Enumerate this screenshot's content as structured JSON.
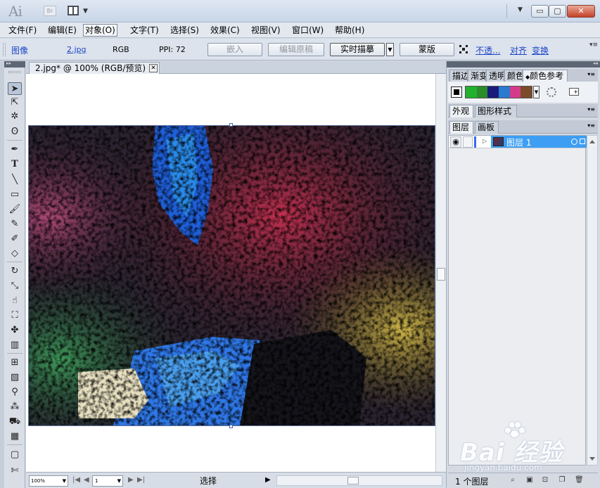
{
  "title_bar": {
    "app_logo": "Ai",
    "bridge_label": "Br"
  },
  "menu": {
    "items": [
      "文件(F)",
      "编辑(E)",
      "对象(O)",
      "文字(T)",
      "选择(S)",
      "效果(C)",
      "视图(V)",
      "窗口(W)",
      "帮助(H)"
    ],
    "active": "对象(O)"
  },
  "control_bar": {
    "object_type": "图像",
    "filename": "2.jpg",
    "color_mode": "RGB",
    "ppi": "PPI: 72",
    "embed": "嵌入",
    "edit_original": "编辑原稿",
    "live_trace": "实时描摹",
    "mask": "蒙版",
    "opacity": "不透...",
    "align": "对齐",
    "transform": "变换"
  },
  "document": {
    "tab_title": "2.jpg* @ 100% (RGB/预览)"
  },
  "status_bar": {
    "zoom": "100%",
    "page": "1",
    "tool": "选择"
  },
  "panels": {
    "group1_tabs": [
      "描边",
      "渐变",
      "透明",
      "颜色",
      "颜色参考"
    ],
    "group1_active": "颜色参考",
    "swatch_colors": [
      "#21b12f",
      "#2a8c2a",
      "#1a1a7a",
      "#2a7acf",
      "#d43c8a",
      "#7a4a2a"
    ],
    "group2_tabs": [
      "外观",
      "图形样式"
    ],
    "group3_tabs": [
      "图层",
      "画板"
    ],
    "layer_name": "图层 1",
    "layer_count": "1 个图层"
  },
  "watermark": {
    "brand": "Bai 经验",
    "url": "jingyan.baidu.com"
  },
  "icons": {
    "tool_icons": [
      "selection-tool-icon",
      "direct-selection-tool-icon",
      "magic-wand-icon",
      "lasso-icon",
      "pen-tool-icon",
      "type-tool-icon",
      "line-tool-icon",
      "rectangle-tool-icon",
      "paintbrush-icon",
      "pencil-icon",
      "blob-brush-icon",
      "eraser-icon",
      "rotate-tool-icon",
      "scale-tool-icon",
      "warp-tool-icon",
      "free-transform-icon",
      "symbol-sprayer-icon",
      "column-graph-icon",
      "mesh-tool-icon",
      "gradient-tool-icon",
      "eyedropper-icon",
      "blend-tool-icon",
      "live-paint-bucket-icon",
      "slice-tool-icon",
      "scissors-icon",
      "hand-tool-icon"
    ]
  }
}
